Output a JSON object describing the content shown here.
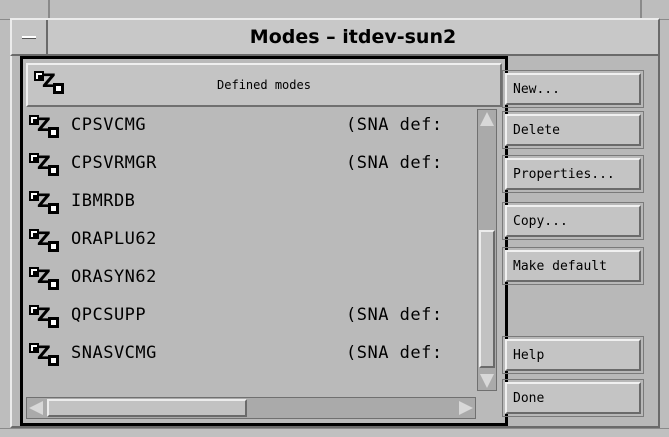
{
  "window": {
    "title": "Modes – itdev-sun2"
  },
  "list": {
    "header": "Defined modes",
    "rows": [
      {
        "name": "CPSVCMG",
        "desc": "(SNA def:"
      },
      {
        "name": "CPSVRMGR",
        "desc": "(SNA def:"
      },
      {
        "name": "IBMRDB",
        "desc": ""
      },
      {
        "name": "ORAPLU62",
        "desc": ""
      },
      {
        "name": "ORASYN62",
        "desc": ""
      },
      {
        "name": "QPCSUPP",
        "desc": "(SNA def:"
      },
      {
        "name": "SNASVCMG",
        "desc": "(SNA def:"
      }
    ]
  },
  "buttons": {
    "new": "New...",
    "delete": "Delete",
    "properties": "Properties...",
    "copy": "Copy...",
    "make_default": "Make default",
    "help": "Help",
    "done": "Done"
  },
  "icons": {
    "window_menu": "window-menu-icon",
    "mode": "mode-icon"
  },
  "colors": {
    "background": "#bdbdbd",
    "panel_border": "#000000"
  }
}
